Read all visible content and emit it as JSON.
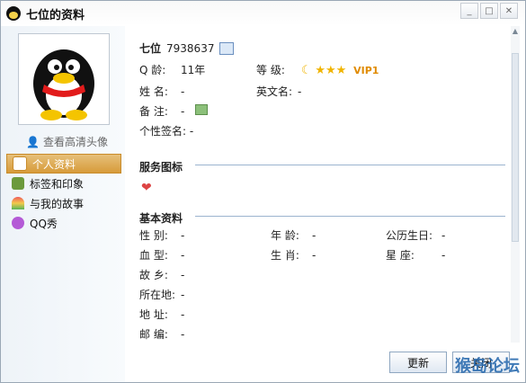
{
  "window": {
    "title": "七位的资料"
  },
  "sidebar": {
    "avatar_link": "查看高清头像",
    "items": [
      {
        "label": "个人资料",
        "active": true
      },
      {
        "label": "标签和印象"
      },
      {
        "label": "与我的故事"
      },
      {
        "label": "QQ秀"
      }
    ]
  },
  "profile": {
    "nickname": "七位",
    "qq_number": "7938637",
    "age_label": "Q 龄:",
    "age_value": "11年",
    "level_label": "等 级:",
    "vip_text": "VIP1",
    "name_label": "姓 名:",
    "name_value": "-",
    "english_label": "英文名:",
    "english_value": "-",
    "remark_label": "备 注:",
    "remark_value": "-",
    "signature_label": "个性签名:",
    "signature_value": "-"
  },
  "sections": {
    "service_icons": "服务图标",
    "basic_info": "基本资料"
  },
  "basic": [
    {
      "label": "性 别:",
      "value": "-"
    },
    {
      "label": "血 型:",
      "value": "-"
    },
    {
      "label": "故 乡:",
      "value": "-"
    },
    {
      "label": "所在地:",
      "value": "-"
    },
    {
      "label": "地 址:",
      "value": "-"
    },
    {
      "label": "邮 编:",
      "value": "-"
    }
  ],
  "basic_mid": [
    {
      "label": "年 龄:",
      "value": "-"
    },
    {
      "label": "生 肖:",
      "value": "-"
    }
  ],
  "basic_right": [
    {
      "label": "公历生日:",
      "value": "-"
    },
    {
      "label": "星 座:",
      "value": "-"
    }
  ],
  "buttons": {
    "refresh": "更新",
    "close": "关闭"
  },
  "watermark": "猴岛论坛"
}
